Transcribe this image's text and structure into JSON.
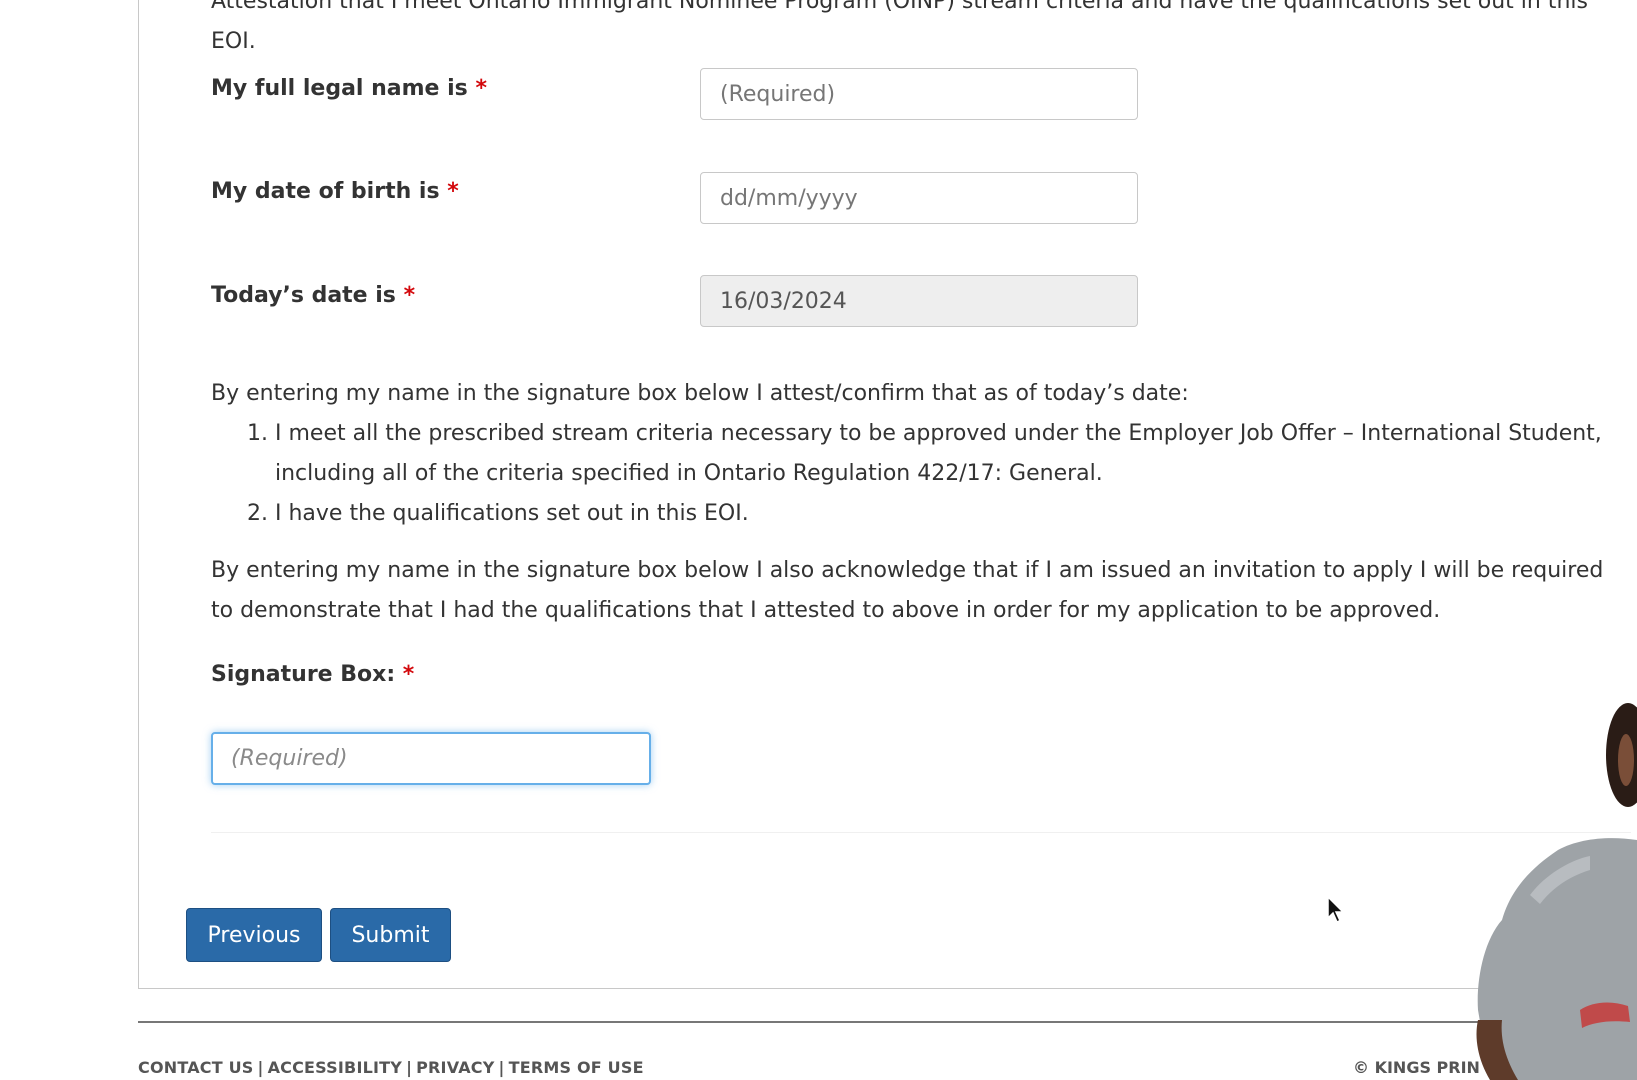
{
  "intro": {
    "text": "Attestation that I meet Ontario Immigrant Nominee Program (OINP) stream criteria and have the qualifications set out in this EOI."
  },
  "fields": {
    "full_name": {
      "label": "My full legal name is",
      "required_mark": "*",
      "placeholder": "(Required)"
    },
    "dob": {
      "label": "My date of birth is",
      "required_mark": "*",
      "placeholder": "dd/mm/yyyy"
    },
    "today": {
      "label": "Today’s date is",
      "required_mark": "*",
      "value": "16/03/2024"
    }
  },
  "attestation": {
    "intro": "By entering my name in the signature box below I attest/confirm that as of today’s date:",
    "items": [
      "I meet all the prescribed stream criteria necessary to be approved under the Employer Job Offer – International Student, including all of the criteria specified in Ontario Regulation 422/17: General.",
      "I have the qualifications set out in this EOI."
    ],
    "acknowledge": "By entering my name in the signature box below I also acknowledge that if I am issued an invitation to apply I will be required to demonstrate that I had the qualifications that I attested to above in order for my application to be approved."
  },
  "signature": {
    "label": "Signature Box:",
    "required_mark": "*",
    "placeholder": "(Required)"
  },
  "buttons": {
    "previous": "Previous",
    "submit": "Submit"
  },
  "footer": {
    "links": [
      "CONTACT US",
      "ACCESSIBILITY",
      "PRIVACY",
      "TERMS OF USE"
    ],
    "separator": "|",
    "copyright": "© KINGS PRIN"
  },
  "colors": {
    "button": "#2a6aa8",
    "required": "#d3080c",
    "focus": "#66afe9"
  }
}
